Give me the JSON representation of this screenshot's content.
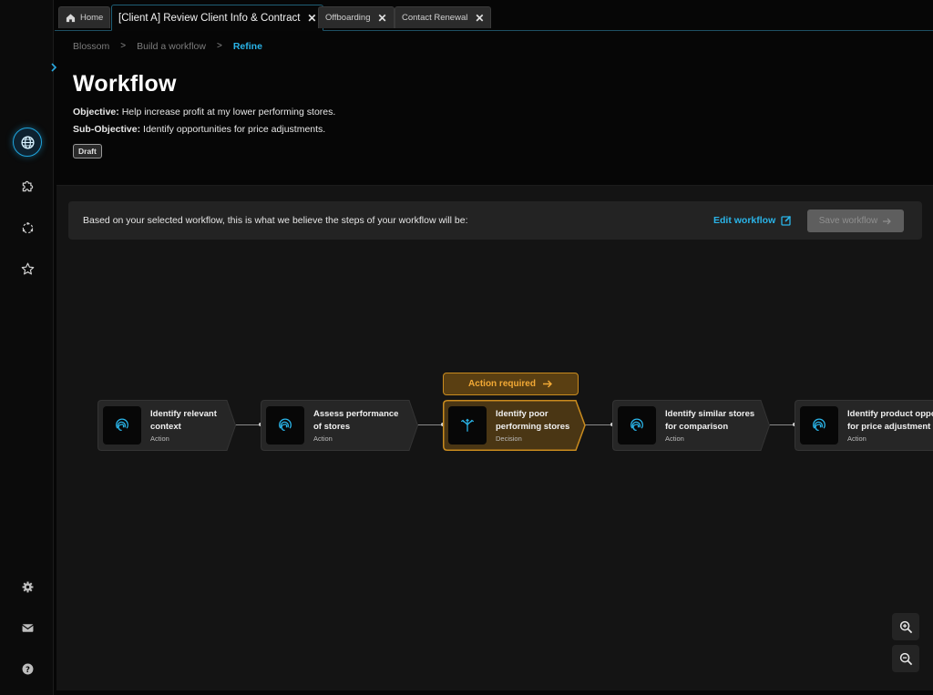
{
  "tabs": [
    {
      "label": "Home",
      "icon": "home-icon",
      "active": false
    },
    {
      "label": "[Client A] Review Client Info & Contract",
      "active": true
    },
    {
      "label": "Offboarding",
      "active": false
    },
    {
      "label": "Contact Renewal",
      "active": false
    }
  ],
  "breadcrumb": [
    "Blossom",
    "Build a workflow",
    "Refine"
  ],
  "page": {
    "title": "Workflow",
    "objective_label": "Objective:",
    "objective_text": " Help increase profit at my lower performing stores.",
    "subobjective_label": "Sub-Objective:",
    "subobjective_text": " Identify opportunities for price adjustments.",
    "status_badge": "Draft"
  },
  "banner": {
    "text": "Based on your selected workflow, this is what we believe the steps of your workflow will be:",
    "edit_label": "Edit workflow",
    "save_label": "Save workflow"
  },
  "action_required": "Action required",
  "nodes": [
    {
      "label": "Identify relevant\ncontext",
      "type": "Action",
      "icon": "fingerprint-icon",
      "highlight": false
    },
    {
      "label": "Assess performance\nof stores",
      "type": "Action",
      "icon": "fingerprint-icon",
      "highlight": false
    },
    {
      "label": "Identify poor\nperforming stores",
      "type": "Decision",
      "icon": "branch-icon",
      "highlight": true
    },
    {
      "label": "Identify similar stores\nfor comparison",
      "type": "Action",
      "icon": "fingerprint-icon",
      "highlight": false
    },
    {
      "label": "Identify product oppo\nfor price adjustment",
      "type": "Action",
      "icon": "fingerprint-icon",
      "highlight": false
    }
  ],
  "rail_icons": [
    "globe-icon",
    "puzzle-icon",
    "network-icon",
    "star-icon",
    "settings-icon",
    "mail-icon",
    "help-icon"
  ],
  "colors": {
    "accent": "#2ab4e8",
    "warning": "#f2a935",
    "warning_border": "#c98b1e"
  }
}
